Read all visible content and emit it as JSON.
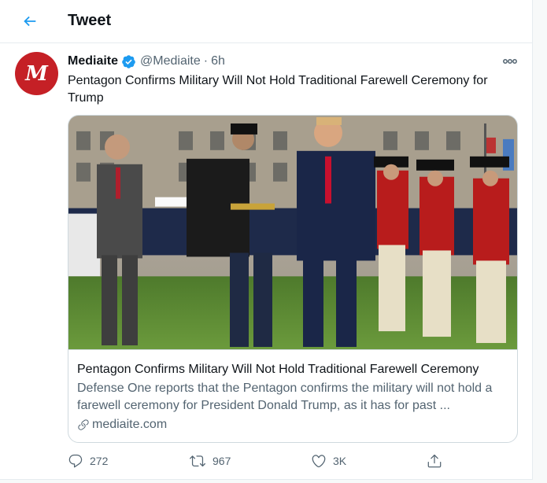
{
  "header": {
    "title": "Tweet",
    "back_icon": "arrow-left-icon"
  },
  "tweet": {
    "avatar_letter": "M",
    "avatar_color": "#c52026",
    "display_name": "Mediaite",
    "verified": true,
    "handle": "@Mediaite",
    "separator": "·",
    "time": "6h",
    "text": "Pentagon Confirms Military Will Not Hold Traditional Farewell Ceremony for Trump"
  },
  "card": {
    "title": "Pentagon Confirms Military Will Not Hold Traditional Farewell Ceremony",
    "description": "Defense One reports that the Pentagon confirms the military will not hold a farewell ceremony for President Donald Trump, as it has for past ...",
    "domain": "mediaite.com",
    "image_icon": "photo-military-ceremony"
  },
  "actions": {
    "replies": "272",
    "retweets": "967",
    "likes": "3K"
  },
  "colors": {
    "accent": "#1d9bf0",
    "text": "#0f1419",
    "secondary": "#536471",
    "border": "#cfd9de"
  }
}
